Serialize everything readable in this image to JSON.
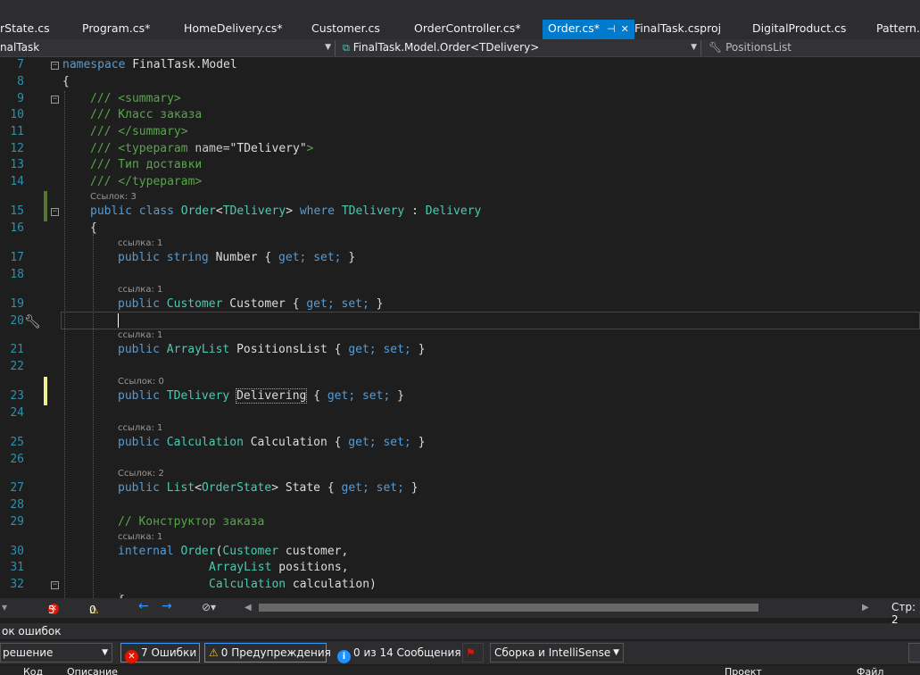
{
  "tabs": [
    {
      "label": "rState.cs"
    },
    {
      "label": "Program.cs*"
    },
    {
      "label": "HomeDelivery.cs*"
    },
    {
      "label": "Customer.cs"
    },
    {
      "label": "OrderController.cs*"
    },
    {
      "label": "Order.cs*",
      "active": true
    },
    {
      "label": "FinalTask.csproj"
    },
    {
      "label": "DigitalProduct.cs"
    },
    {
      "label": "Pattern.cs"
    }
  ],
  "navbar": {
    "project": "nalTask",
    "type": "FinalTask.Model.Order<TDelivery>",
    "member": "PositionsList"
  },
  "code": {
    "ns_kw": "namespace",
    "ns_name": "FinalTask.Model",
    "brace_open": "{",
    "inner_brace_open": "{",
    "doc1": "/// <summary>",
    "doc2": "/// Класс заказа",
    "doc3": "/// </summary>",
    "doc4_a": "/// <typeparam ",
    "doc4_b": "name=",
    "doc4_c": "\"TDelivery\"",
    "doc4_d": ">",
    "doc5": "/// Тип доставки",
    "doc6": "/// </typeparam>",
    "refs_class": "Ссылок: 3",
    "class_public": "public",
    "class_class": "class",
    "class_name": "Order",
    "class_lt": "<",
    "class_tp": "TDelivery",
    "class_gt": ">",
    "class_where": "where",
    "class_tp2": "TDelivery",
    "class_colon": ":",
    "class_base": "Delivery",
    "refs_number": "ссылка: 1",
    "p1_mod": "public",
    "p1_type": "string",
    "p1_name": "Number",
    "refs_customer": "ссылка: 1",
    "p2_mod": "public",
    "p2_type": "Customer",
    "p2_name": "Customer",
    "refs_positions": "ссылка: 1",
    "p3_mod": "public",
    "p3_type": "ArrayList",
    "p3_name": "PositionsList",
    "refs_delivering": "Ссылок: 0",
    "p4_mod": "public",
    "p4_type": "TDelivery",
    "p4_name": "Delivering",
    "refs_calculation": "ссылка: 1",
    "p5_mod": "public",
    "p5_type": "Calculation",
    "p5_name": "Calculation",
    "refs_state": "Ссылок: 2",
    "p6_mod": "public",
    "p6_type": "List",
    "p6_tp": "OrderState",
    "p6_name": "State",
    "ctor_comment": "// Конструктор заказа",
    "refs_ctor": "ссылка: 1",
    "ctor_mod": "internal",
    "ctor_name": "Order",
    "arg1_type": "Customer",
    "arg1_name": "customer,",
    "arg2_type": "ArrayList",
    "arg2_name": "positions,",
    "arg3_type": "Calculation",
    "arg3_name": "calculation)",
    "accessors_open": "{",
    "get_kw": "get;",
    "set_kw": "set;",
    "accessors_close": "}"
  },
  "line_numbers": [
    "7",
    "8",
    "9",
    "10",
    "11",
    "12",
    "13",
    "14",
    "15",
    "16",
    "17",
    "18",
    "19",
    "20",
    "21",
    "22",
    "23",
    "24",
    "25",
    "26",
    "27",
    "28",
    "29",
    "30",
    "31",
    "32"
  ],
  "edit_status": {
    "errors": "5",
    "warnings": "0",
    "position": "Стр: 2"
  },
  "error_list": {
    "title": "ок ошибок",
    "scope": "решение",
    "errors_btn": "7 Ошибки",
    "warnings_btn": "0 Предупреждения",
    "messages_btn": "0 из 14 Сообщения",
    "build_filter": "Сборка и IntelliSense",
    "columns": [
      "Код",
      "Описание",
      "Проект",
      "Файл"
    ]
  }
}
